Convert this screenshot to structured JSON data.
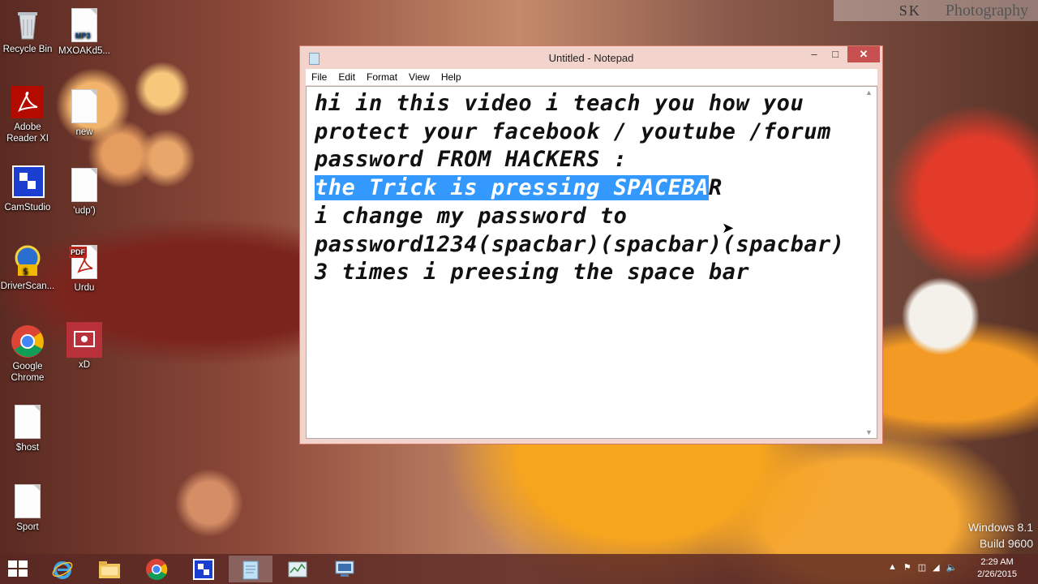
{
  "watermark": {
    "logo": "SK",
    "text": "Photography"
  },
  "desktop_icons": [
    {
      "id": "recycle-bin",
      "label": "Recycle Bin"
    },
    {
      "id": "mp3-file",
      "label": "MXOAKd5...",
      "tag": "MP3"
    },
    {
      "id": "adobe-reader",
      "label": "Adobe Reader XI"
    },
    {
      "id": "new-file",
      "label": "new"
    },
    {
      "id": "camstudio",
      "label": "CamStudio"
    },
    {
      "id": "udp-file",
      "label": "'udp')"
    },
    {
      "id": "driverscanner",
      "label": "DriverScan..."
    },
    {
      "id": "urdu-pdf",
      "label": "Urdu",
      "tag": "PDF"
    },
    {
      "id": "google-chrome",
      "label": "Google Chrome"
    },
    {
      "id": "xd-app",
      "label": "xD"
    },
    {
      "id": "shost-file",
      "label": "$host"
    },
    {
      "id": "sport-file",
      "label": "Sport"
    }
  ],
  "notepad": {
    "title": "Untitled - Notepad",
    "menu": [
      "File",
      "Edit",
      "Format",
      "View",
      "Help"
    ],
    "lines": [
      "hi in this video i teach you how you",
      "protect your facebook / youtube /forum",
      "password FROM HACKERS :",
      "i change my password to",
      "password1234(spacbar)(spacbar)(spacbar)",
      "3 times i preesing the space bar"
    ],
    "selected_line": {
      "selected": "the Trick is pressing SPACEBA",
      "rest": "R"
    }
  },
  "taskbar": {
    "apps": [
      "internet-explorer",
      "file-explorer",
      "google-chrome",
      "camstudio",
      "notepad",
      "task-manager",
      "remote-desktop"
    ],
    "active": "notepad"
  },
  "system": {
    "windows_version": "Windows 8.1",
    "build": "Build 9600",
    "time": "2:29 AM",
    "date": "2/26/2015"
  },
  "colors": {
    "selection": "#3399ff",
    "close_button": "#c75050",
    "window_frame": "#f3d4cd"
  }
}
